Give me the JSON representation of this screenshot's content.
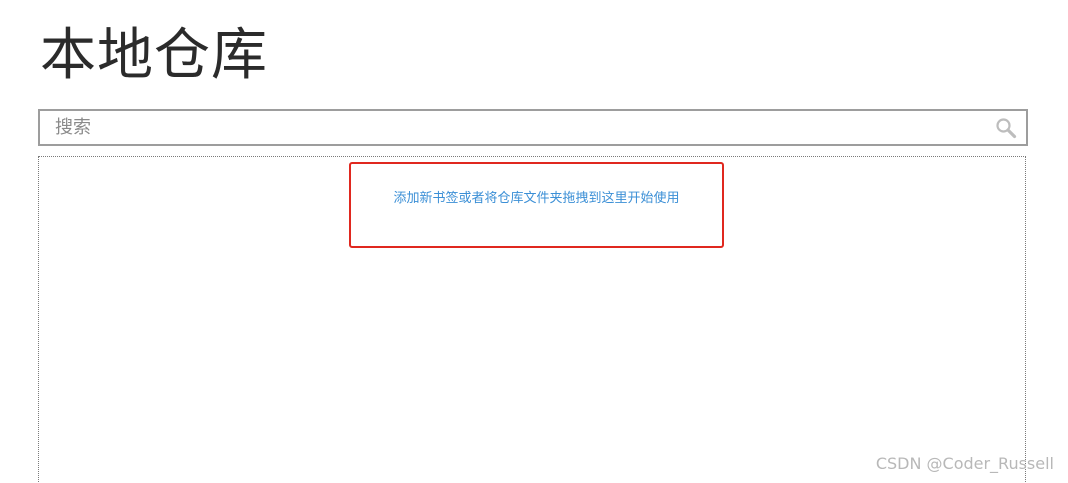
{
  "header": {
    "title": "本地仓库"
  },
  "search": {
    "placeholder": "搜索",
    "value": "",
    "icon": "search-icon"
  },
  "drop_zone": {
    "hint": "添加新书签或者将仓库文件夹拖拽到这里开始使用"
  },
  "highlight": {
    "color": "#e0281f"
  },
  "colors": {
    "hint_link": "#3b8fd6",
    "title": "#2b2b2b"
  },
  "watermark": {
    "text": "CSDN @Coder_Russell"
  }
}
